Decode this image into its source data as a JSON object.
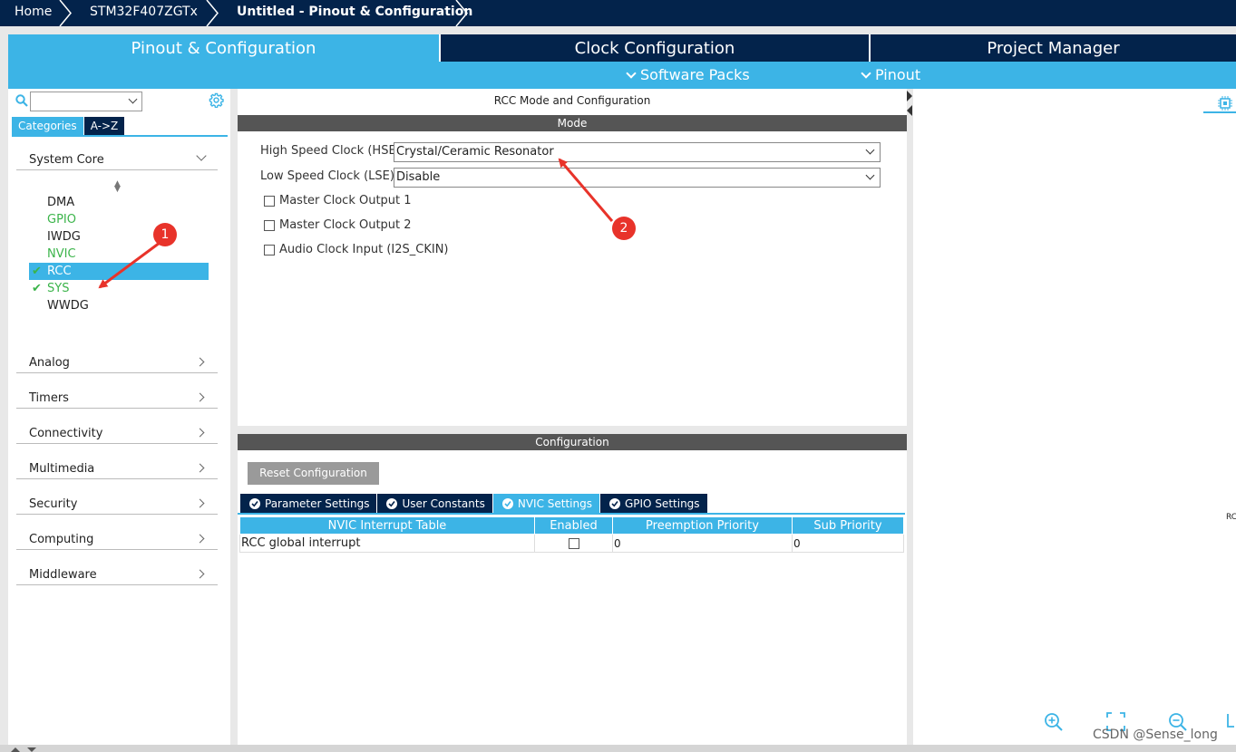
{
  "breadcrumb": {
    "home": "Home",
    "mcu": "STM32F407ZGTx",
    "current": "Untitled - Pinout & Configuration"
  },
  "tabs": {
    "pinout": "Pinout & Configuration",
    "clock": "Clock Configuration",
    "project": "Project Manager"
  },
  "subbar": {
    "software_packs": "Software Packs",
    "pinout": "Pinout"
  },
  "left": {
    "category_tabs": [
      "Categories",
      "A->Z"
    ],
    "system_core": "System Core",
    "peripherals": [
      {
        "name": "DMA",
        "state": "normal"
      },
      {
        "name": "GPIO",
        "state": "green"
      },
      {
        "name": "IWDG",
        "state": "normal"
      },
      {
        "name": "NVIC",
        "state": "green"
      },
      {
        "name": "RCC",
        "state": "selected"
      },
      {
        "name": "SYS",
        "state": "green"
      },
      {
        "name": "WWDG",
        "state": "normal"
      }
    ],
    "groups": [
      "Analog",
      "Timers",
      "Connectivity",
      "Multimedia",
      "Security",
      "Computing",
      "Middleware"
    ]
  },
  "mode": {
    "title": "RCC Mode and Configuration",
    "header": "Mode",
    "hse_label": "High Speed Clock (HSE)",
    "hse_value": "Crystal/Ceramic Resonator",
    "lse_label": "Low Speed Clock (LSE)",
    "lse_value": "Disable",
    "checkboxes": [
      "Master Clock Output 1",
      "Master Clock Output 2",
      "Audio Clock Input (I2S_CKIN)"
    ]
  },
  "config": {
    "header": "Configuration",
    "reset_label": "Reset Configuration",
    "tabs": [
      "Parameter Settings",
      "User Constants",
      "NVIC Settings",
      "GPIO Settings"
    ],
    "active_tab": "NVIC Settings",
    "table": {
      "columns": [
        "NVIC Interrupt Table",
        "Enabled",
        "Preemption Priority",
        "Sub Priority"
      ],
      "rows": [
        {
          "name": "RCC global interrupt",
          "enabled": false,
          "preemption": "0",
          "sub": "0"
        }
      ]
    }
  },
  "right": {
    "edge_label": "RC"
  },
  "annotations": {
    "badge1": "1",
    "badge2": "2"
  },
  "watermark": "CSDN @Sense_long",
  "colors": {
    "navy": "#03234b",
    "accent": "#3cb4e6",
    "green": "#3bb44a",
    "annotation_red": "#e8332a"
  }
}
